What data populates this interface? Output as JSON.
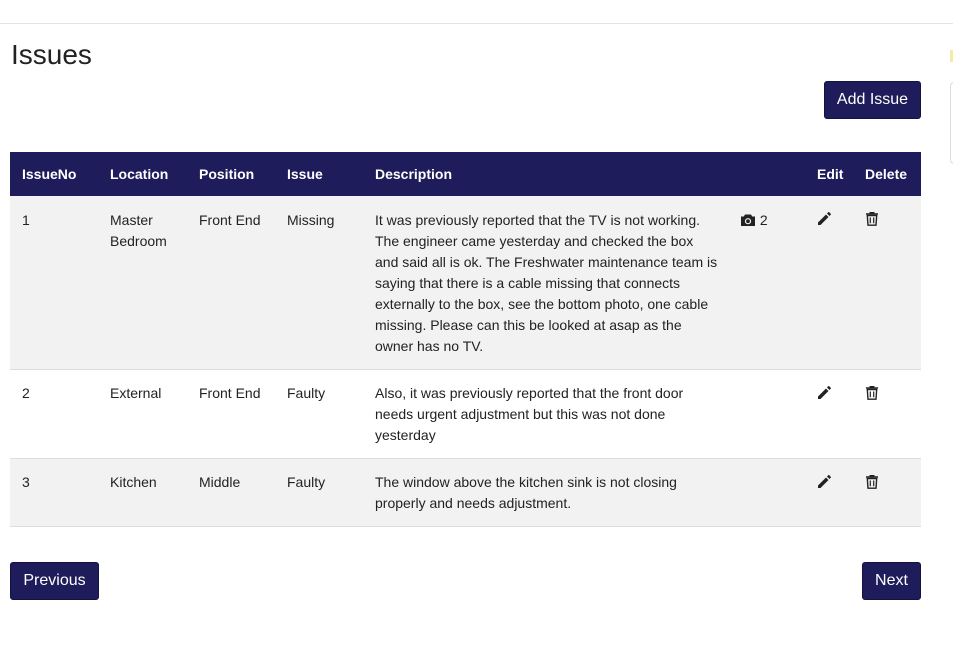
{
  "page": {
    "title": "Issues",
    "add_button": "Add Issue",
    "previous_button": "Previous",
    "next_button": "Next"
  },
  "table": {
    "headers": {
      "issue_no": "IssueNo",
      "location": "Location",
      "position": "Position",
      "issue": "Issue",
      "description": "Description",
      "photos": "",
      "edit": "Edit",
      "delete": "Delete"
    },
    "rows": [
      {
        "issue_no": "1",
        "location": "Master Bedroom",
        "position": "Front End",
        "issue": "Missing",
        "description": "It was previously reported that the TV is not working. The engineer came yesterday and checked the box and said all is ok. The Freshwater maintenance team is saying that there is a cable missing that connects externally to the box, see the bottom photo, one cable missing. Please can this be looked at asap as the owner has no TV.",
        "photo_count": "2",
        "photo_icon": "camera-icon",
        "edit_icon": "pencil-icon",
        "delete_icon": "trash-icon"
      },
      {
        "issue_no": "2",
        "location": "External",
        "position": "Front End",
        "issue": "Faulty",
        "description": "Also, it was previously reported that the front door needs urgent adjustment but this was not done yesterday",
        "photo_count": "",
        "photo_icon": "",
        "edit_icon": "pencil-icon",
        "delete_icon": "trash-icon"
      },
      {
        "issue_no": "3",
        "location": "Kitchen",
        "position": "Middle",
        "issue": "Faulty",
        "description": "The window above the kitchen sink is not closing properly and needs adjustment.",
        "photo_count": "",
        "photo_icon": "",
        "edit_icon": "pencil-icon",
        "delete_icon": "trash-icon"
      }
    ]
  },
  "colors": {
    "primary": "#1e1c5a",
    "row_alt": "#f2f2f2",
    "text": "#222222"
  }
}
